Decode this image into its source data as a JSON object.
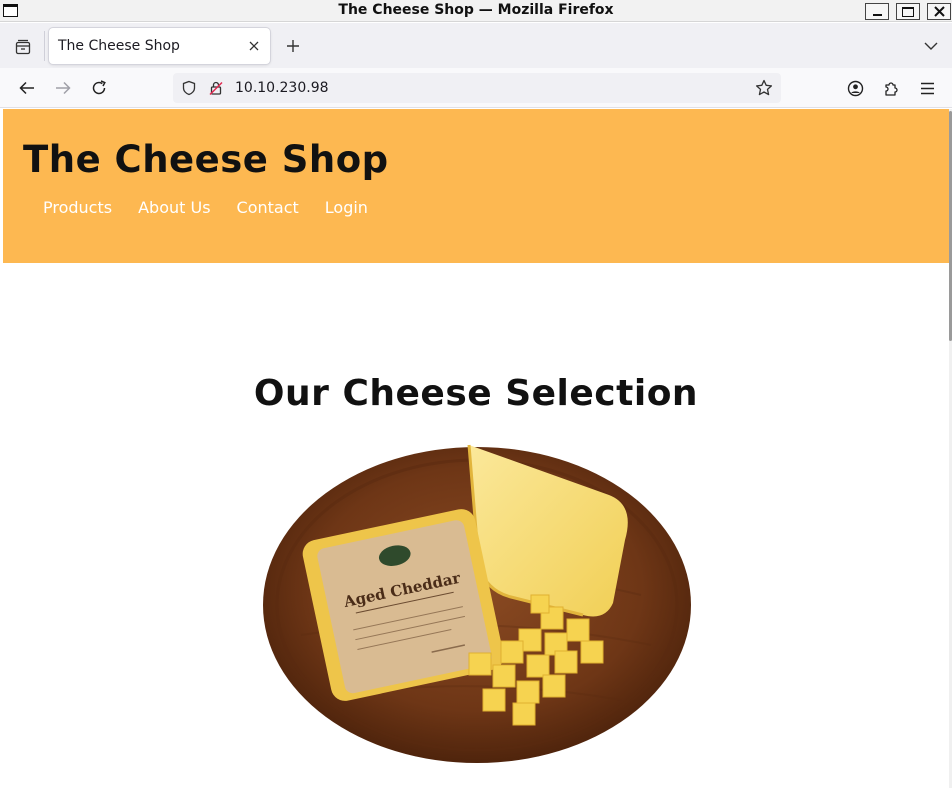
{
  "window": {
    "title": "The Cheese Shop — Mozilla Firefox"
  },
  "tabs": [
    {
      "label": "The Cheese Shop",
      "active": true
    }
  ],
  "navbar": {
    "url": "10.10.230.98"
  },
  "site": {
    "title": "The Cheese Shop",
    "nav": [
      "Products",
      "About Us",
      "Contact",
      "Login"
    ],
    "section_title": "Our Cheese Selection",
    "product_image_label": "Aged Cheddar",
    "header_color": "#fdb851"
  },
  "icons": {
    "window": "window-icon",
    "tab_list": "tab-list-icon",
    "close_tab": "close-icon",
    "new_tab": "plus-icon",
    "all_tabs": "chevron-down-icon",
    "back": "arrow-left-icon",
    "forward": "arrow-right-icon",
    "reload": "reload-icon",
    "tracking": "shield-icon",
    "insecure": "lock-slash-icon",
    "bookmark": "star-icon",
    "account": "account-icon",
    "extensions": "puzzle-icon",
    "menu": "hamburger-icon"
  }
}
